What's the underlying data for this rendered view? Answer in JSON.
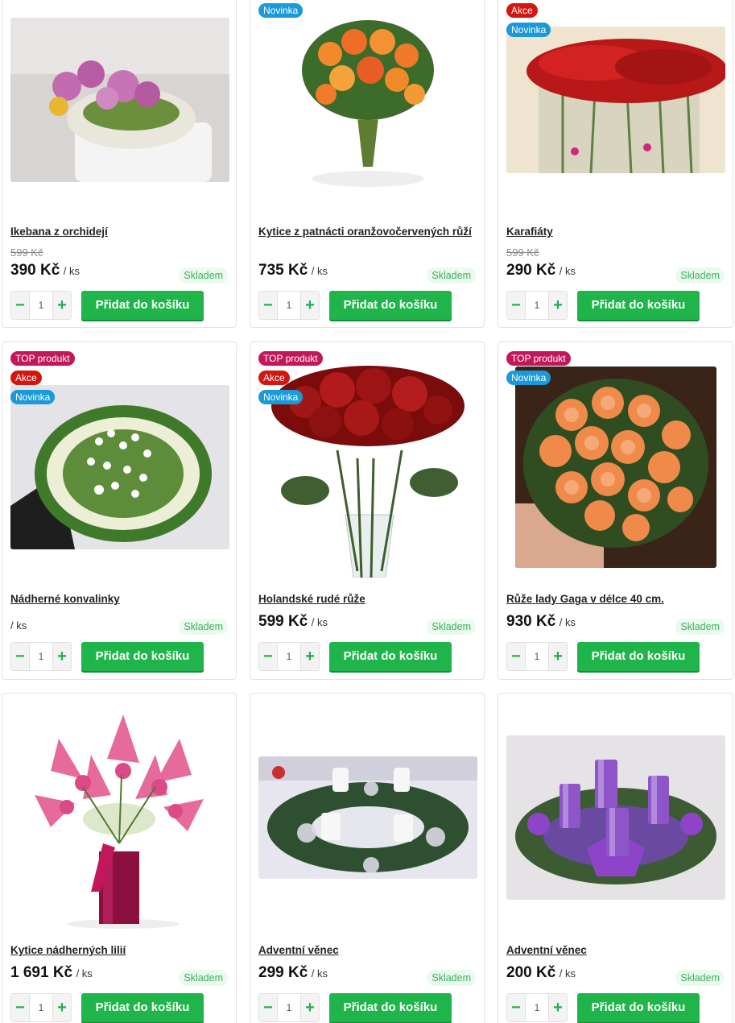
{
  "unit": "/ ks",
  "add_label": "Přidat do košíku",
  "qty_default": "1",
  "stock_label": "Skladem",
  "badges": {
    "top": "TOP produkt",
    "akce": "Akce",
    "novinka": "Novinka"
  },
  "products": [
    {
      "name": "Ikebana z orchidejí",
      "old_price": "599 Kč",
      "price": "390 Kč",
      "badges": []
    },
    {
      "name": "Kytice z patnácti oranžovočervených růží",
      "old_price": "",
      "price": "735 Kč",
      "badges": [
        "Novinka"
      ]
    },
    {
      "name": "Karafiáty",
      "old_price": "599 Kč",
      "price": "290 Kč",
      "badges": [
        "Akce",
        "Novinka"
      ]
    },
    {
      "name": "Nádherné konvalinky",
      "old_price": "",
      "price": "",
      "badges": [
        "TOP produkt",
        "Akce",
        "Novinka"
      ]
    },
    {
      "name": "Holandské rudé růže",
      "old_price": "",
      "price": "599 Kč",
      "badges": [
        "TOP produkt",
        "Akce",
        "Novinka"
      ]
    },
    {
      "name": "Růže lady Gaga v délce 40 cm.",
      "old_price": "",
      "price": "930 Kč",
      "badges": [
        "TOP produkt",
        "Novinka"
      ]
    },
    {
      "name": "Kytice nádherných lilií",
      "old_price": "",
      "price": "1 691 Kč",
      "badges": []
    },
    {
      "name": "Adventní věnec",
      "old_price": "",
      "price": "299 Kč",
      "badges": []
    },
    {
      "name": "Adventní věnec",
      "old_price": "",
      "price": "200 Kč",
      "badges": []
    }
  ],
  "colors": {
    "accent_green": "#20b54a",
    "stock_green": "#3cb15a",
    "badge_top": "#c2185b",
    "badge_akce": "#d3160f",
    "badge_novinka": "#1a9ad9"
  }
}
